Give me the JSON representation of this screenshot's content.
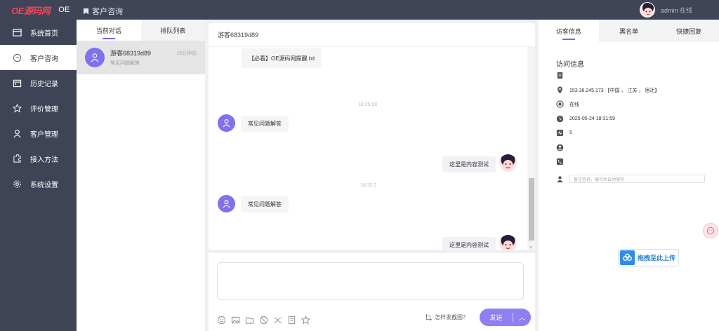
{
  "topbar": {
    "brand": "OE源码网",
    "brand_short": "OE",
    "breadcrumb": "客户咨询",
    "user_status": "admin 在线"
  },
  "sidebar": {
    "items": [
      {
        "label": "系统首页",
        "icon": "monitor-icon"
      },
      {
        "label": "客户咨询",
        "icon": "chat-icon"
      },
      {
        "label": "历史记录",
        "icon": "calendar-icon"
      },
      {
        "label": "评价管理",
        "icon": "star-icon"
      },
      {
        "label": "客户管理",
        "icon": "user-icon"
      },
      {
        "label": "接入方法",
        "icon": "puzzle-icon"
      },
      {
        "label": "系统设置",
        "icon": "gear-icon"
      }
    ],
    "active_index": 1
  },
  "conversations": {
    "tabs": [
      "当前对话",
      "排队列表"
    ],
    "items": [
      {
        "name": "游客68319d89",
        "preview": "常见问题解答",
        "time": "10分钟前"
      }
    ]
  },
  "chat": {
    "title": "游客68319d89",
    "messages": [
      {
        "text": "【必看】OE源码网提醒.txt"
      },
      {
        "timestamp": "18:25:58"
      },
      {
        "text": "常见问题解答"
      },
      {
        "text": "这里是内容测试"
      },
      {
        "timestamp": "18:32:2"
      },
      {
        "text": "常见问题解答"
      },
      {
        "text": "这里是内容测试"
      }
    ]
  },
  "composer": {
    "screenshot_tip": "怎样发截图？",
    "send_label": "发送",
    "tools": [
      "smile-icon",
      "image-icon",
      "folder-icon",
      "ban-icon",
      "shuffle-icon",
      "document-icon",
      "star-outline-icon"
    ]
  },
  "visitor": {
    "tabs": [
      "访客信息",
      "黑名单",
      "快捷回复"
    ],
    "title": "访问信息",
    "ip": "153.36.245.173 【中国 ， 江苏 ， 宿迁】",
    "status": "在线",
    "time": "2025-05-24 18:31:59",
    "visits": "5",
    "remark_placeholder": "备注信息，编写后自动保存"
  },
  "upload": {
    "label": "拖拽至此上传"
  },
  "colors": {
    "accent": "#6e6bef",
    "sidebar": "#3f4356",
    "topbar": "#404457",
    "avatar": "#7f71ef"
  }
}
